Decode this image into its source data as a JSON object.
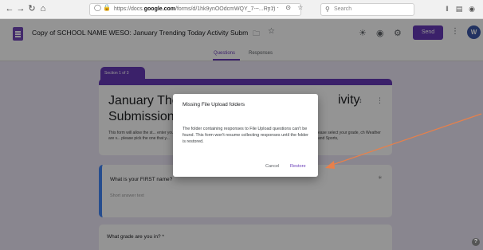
{
  "browser": {
    "url_prefix": "https://docs.",
    "url_domain": "google.com",
    "url_rest": "/forms/d/1hk9ynOOdcmWQY_7-~...Ry1)",
    "url_actions": "··· ⊙ ☆",
    "search_placeholder": "Search"
  },
  "header": {
    "title": "Copy of SCHOOL NAME WESO: January Trending Today Activity Subm",
    "send_label": "Send",
    "avatar_letter": "W",
    "accent": "#673ab7"
  },
  "tabs": [
    {
      "label": "Questions"
    },
    {
      "label": "Responses"
    }
  ],
  "section": {
    "badge": "Section 1 of 3"
  },
  "form": {
    "title_line1": "January The",
    "title_line2": "Submission",
    "title_right": "ivity",
    "desc_left": "This form will allow the st... enter your student. © are v... please pick the one that y...",
    "desc_right": "ease select your grade, ch Weather and Sports,"
  },
  "questions": [
    {
      "label": "What is your FIRST name?",
      "placeholder": "Short answer text"
    },
    {
      "label": "What grade are you in? *"
    }
  ],
  "dialog": {
    "title": "Missing File Upload folders",
    "body": "The folder containing responses to File Upload questions can't be found. This form won't resume collecting responses until the folder is restored.",
    "cancel": "Cancel",
    "restore": "Restore"
  },
  "annotation_color": "#e8804a"
}
